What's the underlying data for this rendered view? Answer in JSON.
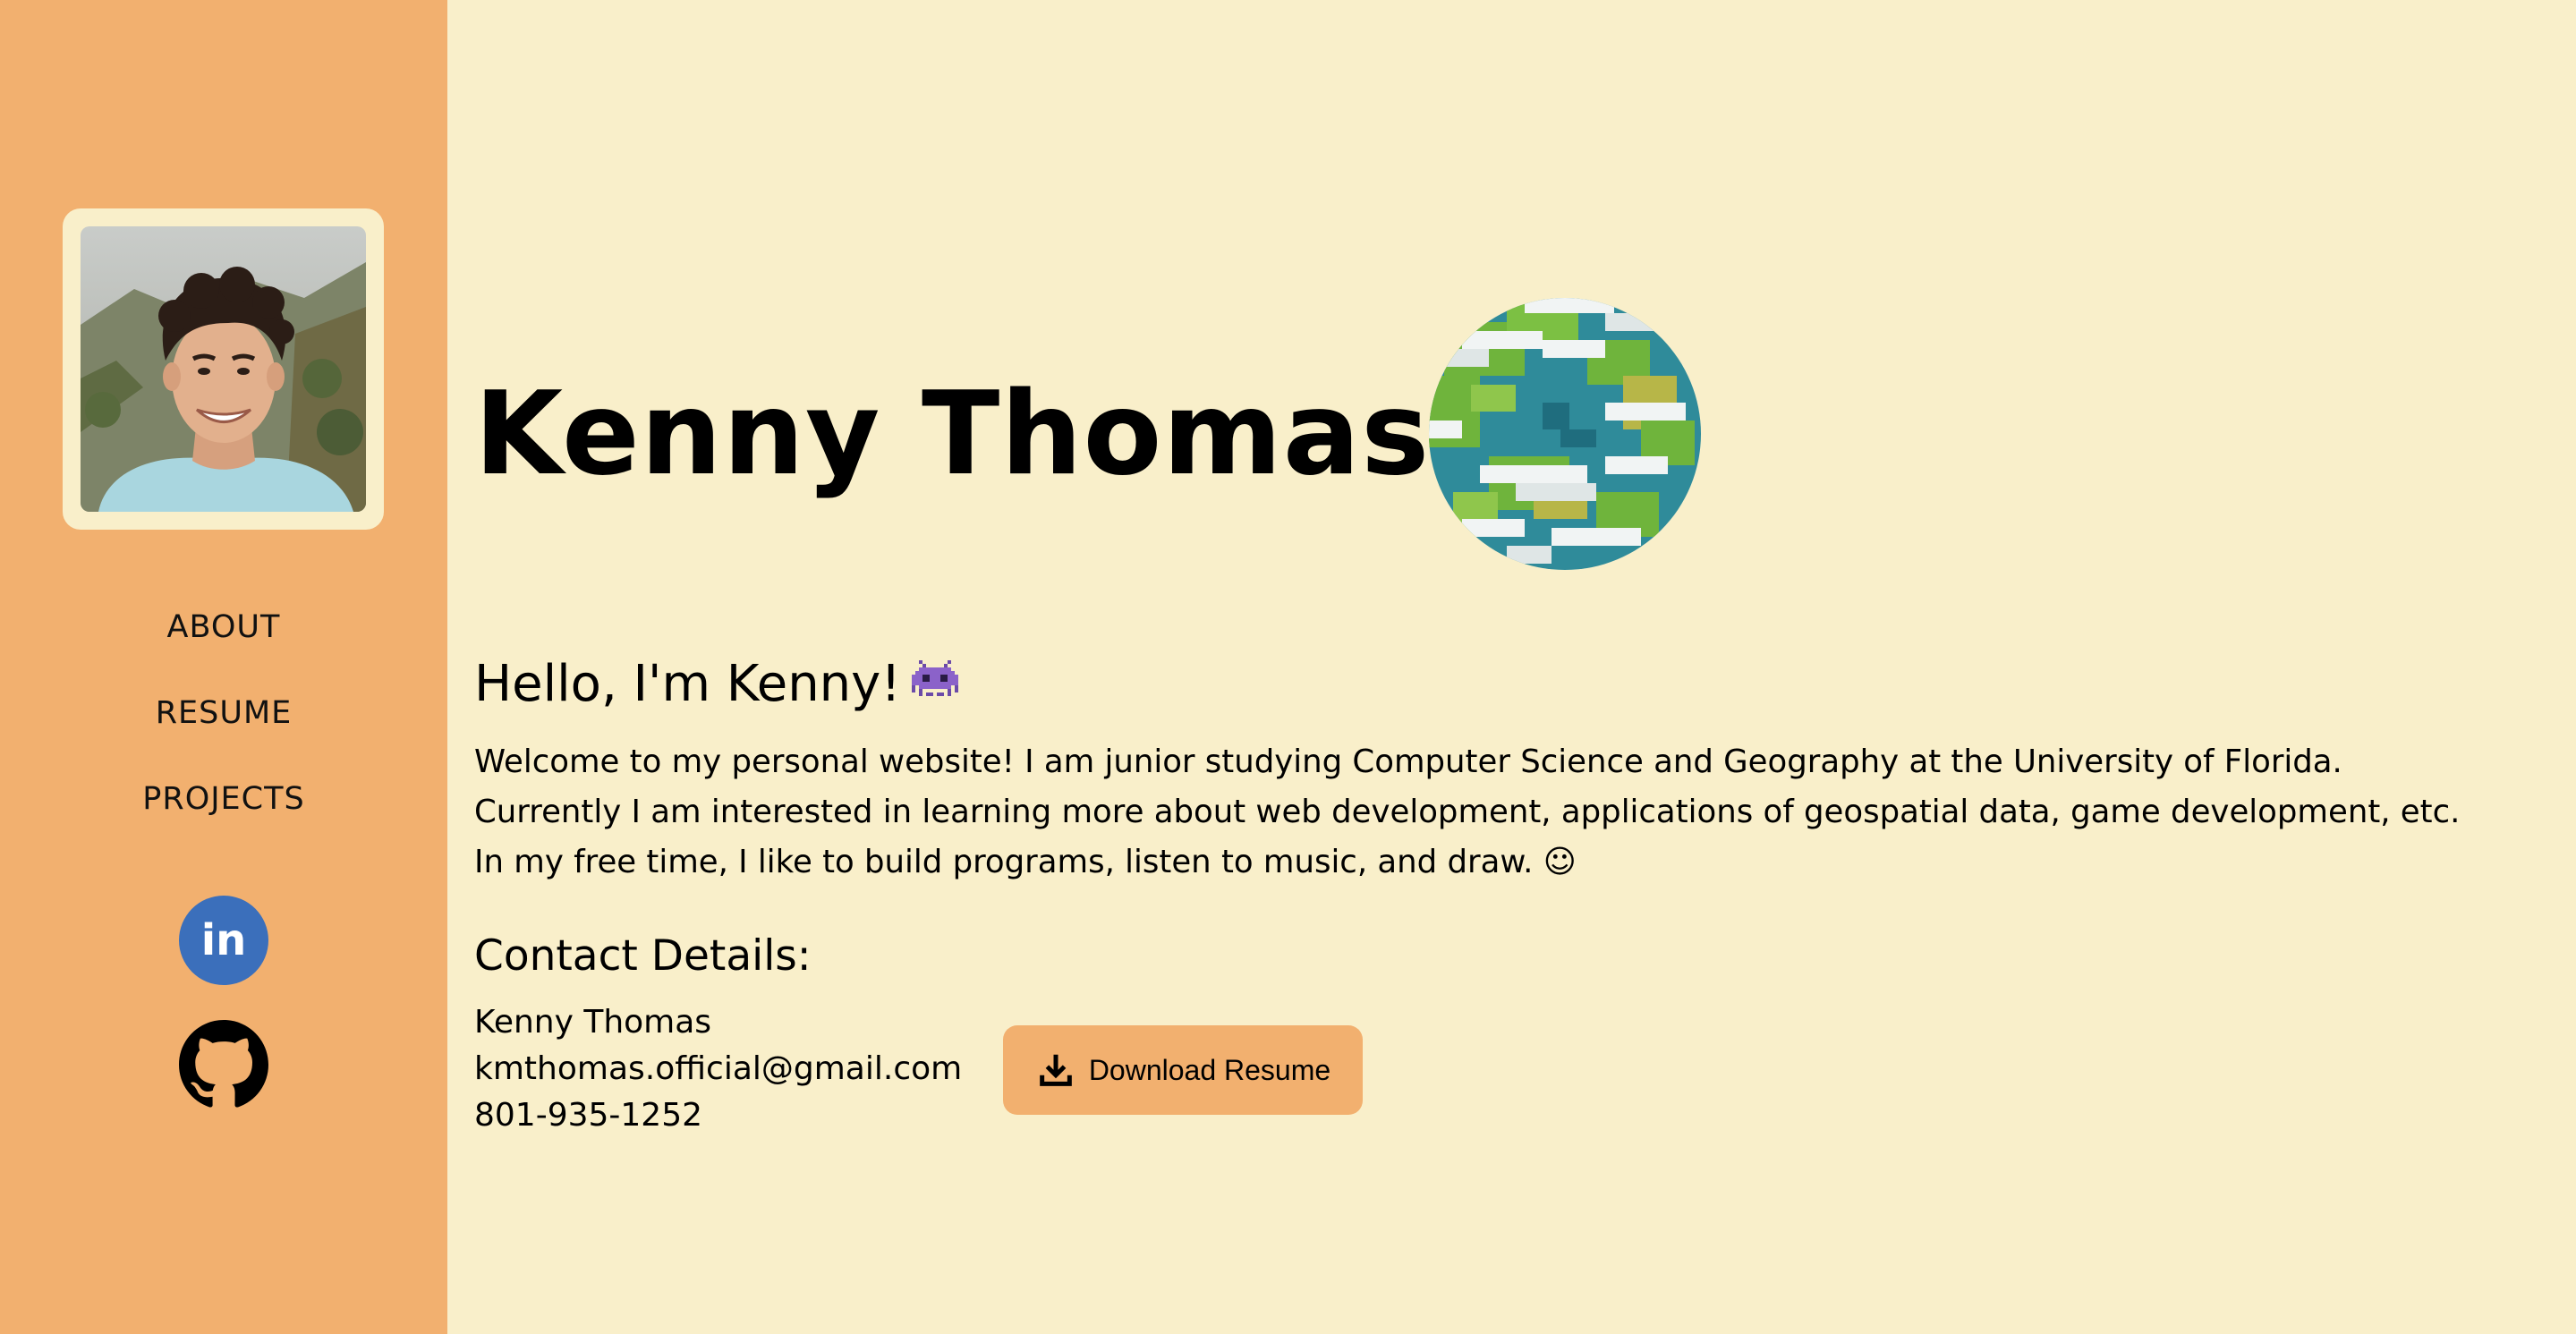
{
  "colors": {
    "sidebar_bg": "#f2b06f",
    "page_bg": "#f9efca",
    "linkedin_blue": "#3b6fbb",
    "button_bg": "#f2b06f"
  },
  "sidebar": {
    "avatar_alt": "Profile photo of Kenny Thomas",
    "nav": [
      {
        "label": "ABOUT"
      },
      {
        "label": "RESUME"
      },
      {
        "label": "PROJECTS"
      }
    ],
    "social": [
      {
        "icon": "linkedin-icon",
        "label": "in"
      },
      {
        "icon": "github-icon"
      }
    ]
  },
  "header": {
    "title": "Kenny Thomas",
    "globe_icon": "pixel-earth-icon"
  },
  "about": {
    "greeting": "Hello, I'm Kenny!",
    "greeting_icon": "alien-monster-icon",
    "intro": [
      "Welcome to my personal website! I am junior studying Computer Science and Geography at the University of Florida.",
      "Currently I am interested in learning more about web development, applications of geospatial data, game development, etc.",
      "In my free time, I like to build programs, listen to music, and draw. ☺"
    ]
  },
  "contact": {
    "heading": "Contact Details:",
    "name": "Kenny Thomas",
    "email": "kmthomas.official@gmail.com",
    "phone": "801-935-1252",
    "download_label": "Download Resume",
    "download_icon": "download-icon"
  }
}
